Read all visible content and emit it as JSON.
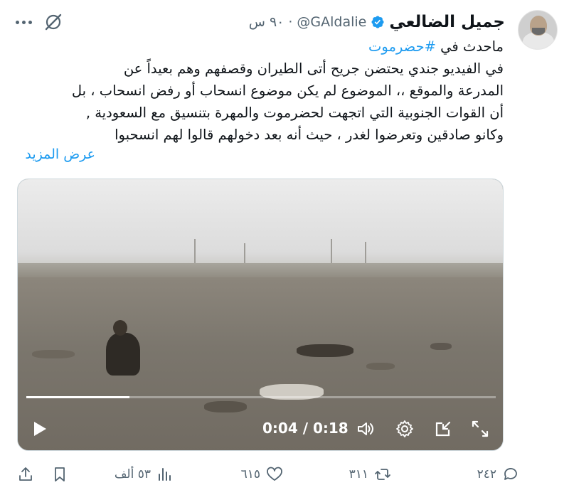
{
  "author": {
    "name": "جميل الضالعي",
    "handle": "@GAldalie",
    "separator": "·",
    "time": "٩٠ س",
    "verified_color": "#1d9bf0"
  },
  "post": {
    "lines": [
      {
        "prefix": "ماحدث في ",
        "hashtag": "#حضرموت"
      },
      {
        "text": "في الفيديو جندي يحتضن جريح أتى الطيران وقصفهم وهم بعيداً عن"
      },
      {
        "text": "المدرعة والموقع ،، الموضوع لم يكن موضوع انسحاب أو رفض انسحاب ، بل"
      },
      {
        "text": "أن القوات الجنوبية التي اتجهت لحضرموت والمهرة بتنسيق مع السعودية ,"
      },
      {
        "text": "وكانو صادقين وتعرضوا لغدر ، حيث أنه بعد دخولهم قالوا لهم انسحبوا"
      }
    ],
    "show_more": "عرض المزيد"
  },
  "video": {
    "time_label": "0:04 / 0:18",
    "progress": 0.22
  },
  "actions": {
    "replies": "٢٤٢",
    "reposts": "٣١١",
    "likes": "٦١٥",
    "views": "٥٣ ألف"
  },
  "icons": {
    "grok": "grok-icon",
    "more": "more-icon",
    "play": "play-icon",
    "volume": "volume-icon",
    "settings": "settings-icon",
    "exit_fullscreen": "minimize-icon",
    "fullscreen": "fullscreen-icon",
    "reply": "reply-icon",
    "repost": "repost-icon",
    "like": "heart-icon",
    "views": "views-icon",
    "bookmark": "bookmark-icon",
    "share": "share-icon"
  },
  "colors": {
    "accent": "#1d9bf0",
    "text": "#0f1419",
    "secondary": "#536471"
  }
}
